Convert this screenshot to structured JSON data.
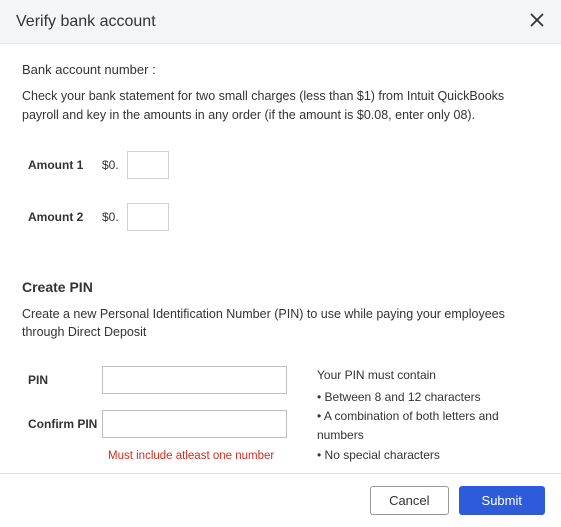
{
  "header": {
    "title": "Verify bank account"
  },
  "bank": {
    "label": "Bank account number :",
    "instruction": "Check your bank statement for two small charges (less than $1) from Intuit QuickBooks payroll and key in the amounts in any order (if the amount is $0.08, enter only 08).",
    "amount1_label": "Amount 1",
    "amount2_label": "Amount 2",
    "dollar_prefix": "$0.",
    "amount1_value": "",
    "amount2_value": ""
  },
  "pin": {
    "heading": "Create PIN",
    "instruction": "Create a new Personal Identification Number (PIN) to use while paying your employees through Direct Deposit",
    "pin_label": "PIN",
    "confirm_label": "Confirm PIN",
    "pin_value": "",
    "confirm_value": "",
    "error": "Must include atleast one number",
    "req_title": "Your PIN must contain",
    "req1": "• Between 8 and 12 characters",
    "req2": "• A combination of both letters and numbers",
    "req3": "• No special characters"
  },
  "footer": {
    "cancel": "Cancel",
    "submit": "Submit"
  }
}
